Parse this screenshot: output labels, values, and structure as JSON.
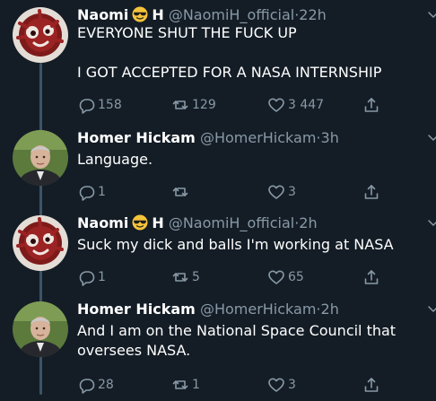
{
  "tweets": [
    {
      "name_first": "Naomi",
      "name_last": "H",
      "has_emoji": true,
      "handle": "@NaomiH_official",
      "time": "22h",
      "text": "EVERYONE SHUT THE FUCK UP\n\nI GOT ACCEPTED FOR A NASA INTERNSHIP",
      "reply_count": "158",
      "retweet_count": "129",
      "like_count": "3 447"
    },
    {
      "name_first": "Homer Hickam",
      "name_last": "",
      "has_emoji": false,
      "handle": "@HomerHickam",
      "time": "3h",
      "text": "Language.",
      "reply_count": "1",
      "retweet_count": "",
      "like_count": "3"
    },
    {
      "name_first": "Naomi",
      "name_last": "H",
      "has_emoji": true,
      "handle": "@NaomiH_official",
      "time": "2h",
      "text": "Suck my dick and balls I'm working at NASA",
      "reply_count": "1",
      "retweet_count": "5",
      "like_count": "65"
    },
    {
      "name_first": "Homer Hickam",
      "name_last": "",
      "has_emoji": false,
      "handle": "@HomerHickam",
      "time": "2h",
      "text": "And I am on the National Space Council that\noversees NASA.",
      "reply_count": "28",
      "retweet_count": "1",
      "like_count": "3"
    }
  ],
  "separator": "·",
  "icons": {
    "reply": "reply-icon",
    "retweet": "retweet-icon",
    "like": "heart-icon",
    "share": "share-icon",
    "more": "chevron-down-icon",
    "emoji": "sunglasses-emoji-icon"
  },
  "colors": {
    "background": "#141d26",
    "text": "#ffffff",
    "secondary": "#8899a6",
    "thread_line": "#3d5466"
  }
}
